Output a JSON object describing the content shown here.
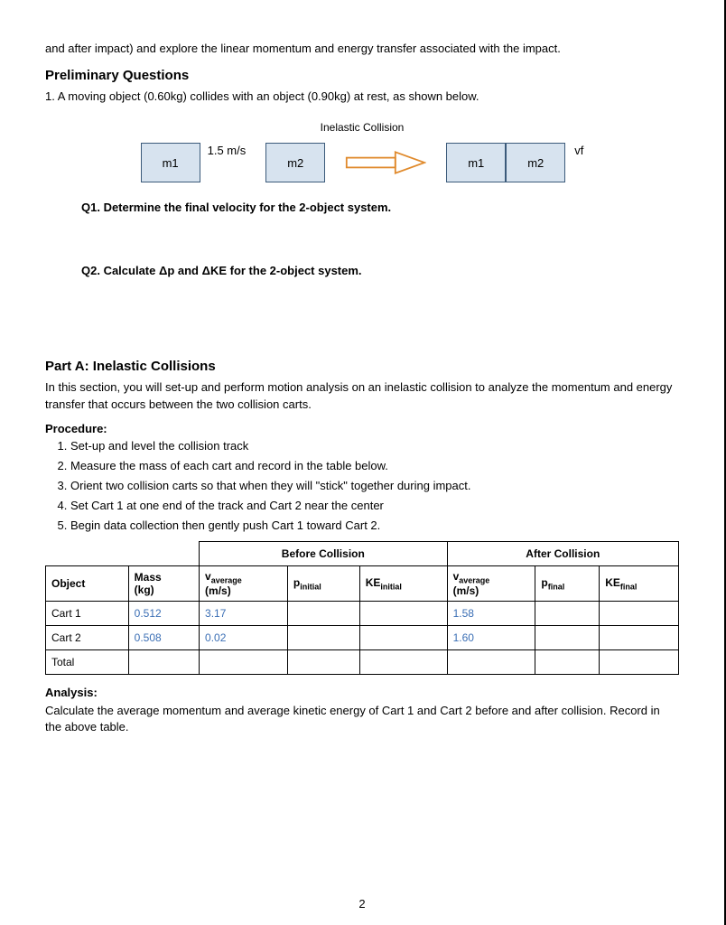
{
  "intro": "and after impact) and explore the linear momentum and energy transfer associated with the impact.",
  "prelim": {
    "heading": "Preliminary Questions",
    "q_intro": "1. A moving object (0.60kg) collides with an object (0.90kg) at rest, as shown below.",
    "diagram_title": "Inelastic Collision",
    "m1": "m1",
    "m2": "m2",
    "speed": "1.5 m/s",
    "vf": "vf",
    "q1": "Q1. Determine the final velocity for the 2-object system.",
    "q2": "Q2. Calculate Δp and ΔKE for the 2-object system."
  },
  "partA": {
    "heading": "Part A: Inelastic Collisions",
    "desc": "In this section, you will set-up and perform motion analysis on an inelastic collision to analyze the momentum and energy transfer that occurs between the two collision carts.",
    "procedure_heading": "Procedure:",
    "steps": [
      "Set-up and level the collision track",
      "Measure the mass of each cart and record in the table below.",
      "Orient two collision carts so that when they will \"stick\" together during impact.",
      "Set Cart 1 at one end of the track and Cart 2 near the center",
      "Begin data collection then gently push Cart 1 toward Cart 2."
    ],
    "table": {
      "before": "Before Collision",
      "after": "After Collision",
      "object": "Object",
      "mass": "Mass (kg)",
      "vavg": "v",
      "vavg_sub": "average",
      "vunit": "(m/s)",
      "pinit": "p",
      "pinit_sub": "initial",
      "keinit": "KE",
      "keinit_sub": "initial",
      "pfinal": "p",
      "pfinal_sub": "final",
      "kefinal": "KE",
      "kefinal_sub": "final",
      "rows": [
        {
          "obj": "Cart 1",
          "mass": "0.512",
          "vb": "3.17",
          "va": "1.58"
        },
        {
          "obj": "Cart 2",
          "mass": "0.508",
          "vb": "0.02",
          "va": "1.60"
        },
        {
          "obj": "Total",
          "mass": "",
          "vb": "",
          "va": ""
        }
      ]
    },
    "analysis_heading": "Analysis:",
    "analysis": "Calculate the average momentum and average kinetic energy of Cart 1 and Cart 2 before and after collision. Record in the above table."
  },
  "pagenum": "2"
}
